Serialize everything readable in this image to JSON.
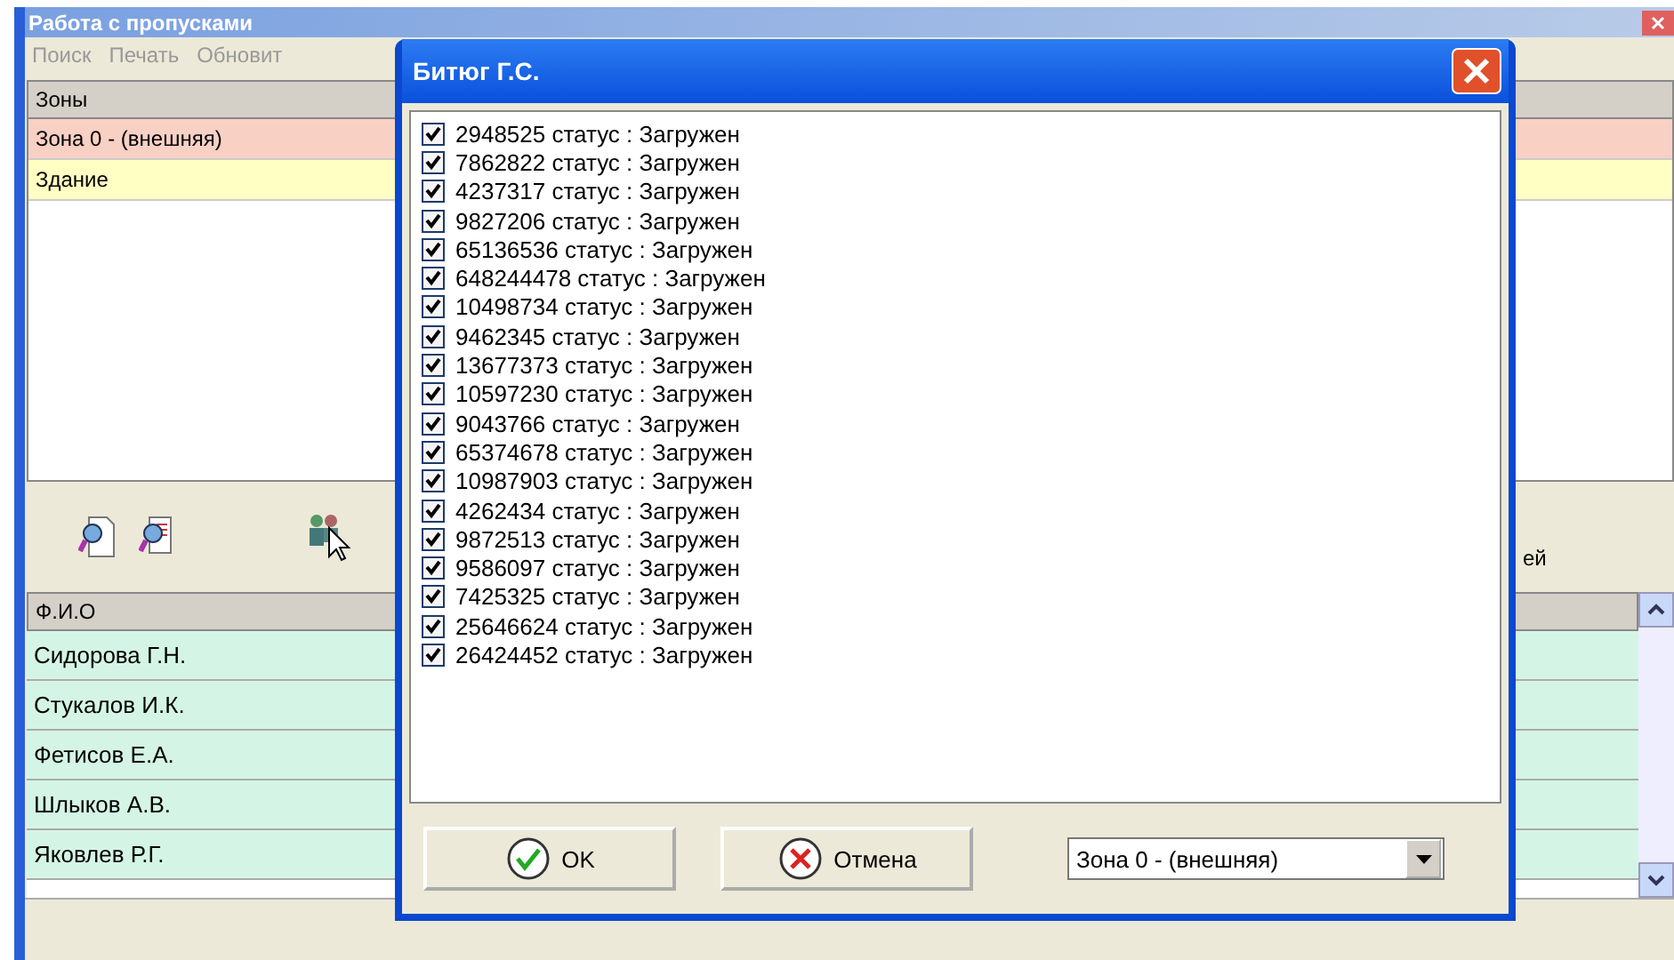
{
  "window": {
    "title": "Работа с пропусками"
  },
  "menu": [
    "Поиск",
    "Печать",
    "Обновит"
  ],
  "zones": {
    "header": "Зоны",
    "rows": [
      {
        "name": "Зона 0 - (внешняя)",
        "color": "#f8d0c4"
      },
      {
        "name": "Здание",
        "color": "#ffffc4"
      }
    ]
  },
  "toolbar": {
    "label_fragment": "ей"
  },
  "people": {
    "header": "Ф.И.О",
    "rows": [
      "Сидорова Г.Н.",
      "Стукалов И.К.",
      "Фетисов Е.А.",
      "Шлыков А.В.",
      "Яковлев Р.Г."
    ]
  },
  "dialog": {
    "title": "Битюг Г.С.",
    "items": [
      {
        "text": "2948525 статус : Загружен",
        "checked": true
      },
      {
        "text": "7862822 статус : Загружен",
        "checked": true
      },
      {
        "text": "4237317 статус : Загружен",
        "checked": true
      },
      {
        "text": "9827206 статус : Загружен",
        "checked": true
      },
      {
        "text": "65136536 статус : Загружен",
        "checked": true
      },
      {
        "text": "648244478 статус : Загружен",
        "checked": true
      },
      {
        "text": "10498734 статус : Загружен",
        "checked": true
      },
      {
        "text": "9462345 статус : Загружен",
        "checked": true
      },
      {
        "text": "13677373 статус : Загружен",
        "checked": true
      },
      {
        "text": "10597230 статус : Загружен",
        "checked": true
      },
      {
        "text": "9043766 статус : Загружен",
        "checked": true
      },
      {
        "text": "65374678 статус : Загружен",
        "checked": true
      },
      {
        "text": "10987903 статус : Загружен",
        "checked": true
      },
      {
        "text": "4262434 статус : Загружен",
        "checked": true
      },
      {
        "text": "9872513 статус : Загружен",
        "checked": true
      },
      {
        "text": "9586097 статус : Загружен",
        "checked": true
      },
      {
        "text": "7425325 статус : Загружен",
        "checked": true
      },
      {
        "text": "25646624 статус : Загружен",
        "checked": true
      },
      {
        "text": "26424452 статус : Загружен",
        "checked": true
      }
    ],
    "ok": "OK",
    "cancel": "Отмена",
    "zone": "Зона 0 - (внешняя)"
  }
}
